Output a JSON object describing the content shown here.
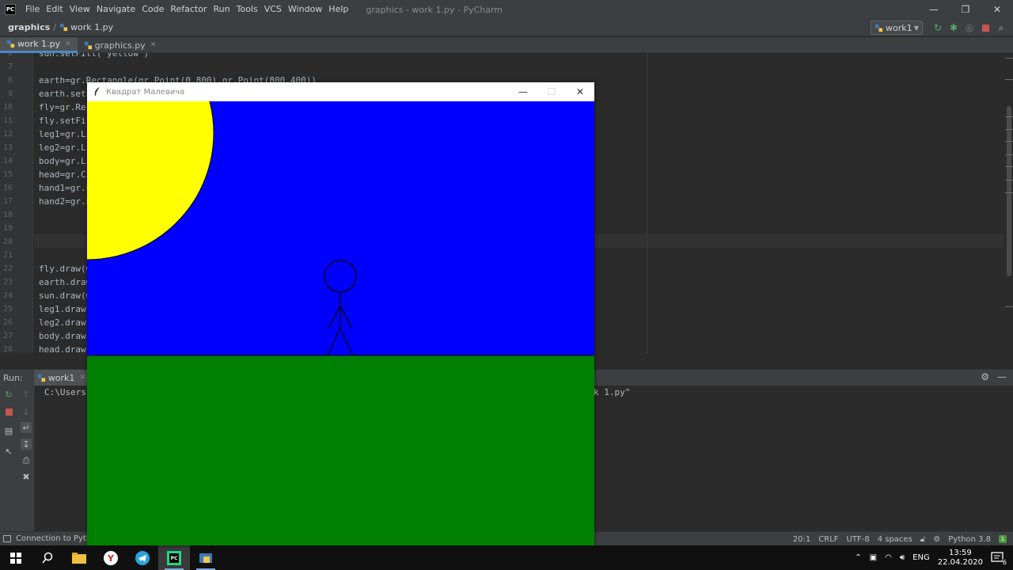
{
  "titlebar": {
    "logo_text": "PC",
    "menu": [
      "File",
      "Edit",
      "View",
      "Navigate",
      "Code",
      "Refactor",
      "Run",
      "Tools",
      "VCS",
      "Window",
      "Help"
    ],
    "window_title": "graphics - work 1.py - PyCharm"
  },
  "navbar": {
    "project": "graphics",
    "file": "work 1.py",
    "run_config": "work1"
  },
  "editor_tabs": [
    {
      "label": "work 1.py",
      "active": true
    },
    {
      "label": "graphics.py",
      "active": false
    }
  ],
  "editor": {
    "lines": [
      {
        "n": "6",
        "code": "sun.setFill('yellow')"
      },
      {
        "n": "7",
        "code": ""
      },
      {
        "n": "8",
        "code": "earth=gr.Rectangle(gr.Point(0,800),gr.Point(800,400))"
      },
      {
        "n": "9",
        "code": "earth.setF"
      },
      {
        "n": "10",
        "code": "fly=gr.Rec"
      },
      {
        "n": "11",
        "code": "fly.setFil"
      },
      {
        "n": "12",
        "code": "leg1=gr.Li"
      },
      {
        "n": "13",
        "code": "leg2=gr.Li"
      },
      {
        "n": "14",
        "code": "body=gr.Li"
      },
      {
        "n": "15",
        "code": "head=gr.Ci"
      },
      {
        "n": "16",
        "code": "hand1=gr.L"
      },
      {
        "n": "17",
        "code": "hand2=gr.L"
      },
      {
        "n": "18",
        "code": ""
      },
      {
        "n": "19",
        "code": ""
      },
      {
        "n": "20",
        "code": ""
      },
      {
        "n": "21",
        "code": ""
      },
      {
        "n": "22",
        "code": "fly.draw(w"
      },
      {
        "n": "23",
        "code": "earth.draw"
      },
      {
        "n": "24",
        "code": "sun.draw(w"
      },
      {
        "n": "25",
        "code": "leg1.draw("
      },
      {
        "n": "26",
        "code": "leg2.draw("
      },
      {
        "n": "27",
        "code": "body.draw("
      },
      {
        "n": "28",
        "code": "head.draw("
      }
    ]
  },
  "run_panel": {
    "label": "Run:",
    "tab": "work1",
    "console_left": "C:\\Users\\",
    "console_right": "k 1.py\""
  },
  "statusbar": {
    "left": "Connection to Pytho",
    "position": "20:1",
    "line_sep": "CRLF",
    "encoding": "UTF-8",
    "indent": "4 spaces",
    "interpreter": "Python 3.8",
    "events": "1"
  },
  "taskbar": {
    "lang": "ENG",
    "time": "13:59",
    "date": "22.04.2020",
    "notif_count": "6"
  },
  "graphics_window": {
    "title": "Квадрат Малевича",
    "colors": {
      "sky": "#0000ff",
      "earth": "#008000",
      "sun": "#ffff00"
    }
  }
}
